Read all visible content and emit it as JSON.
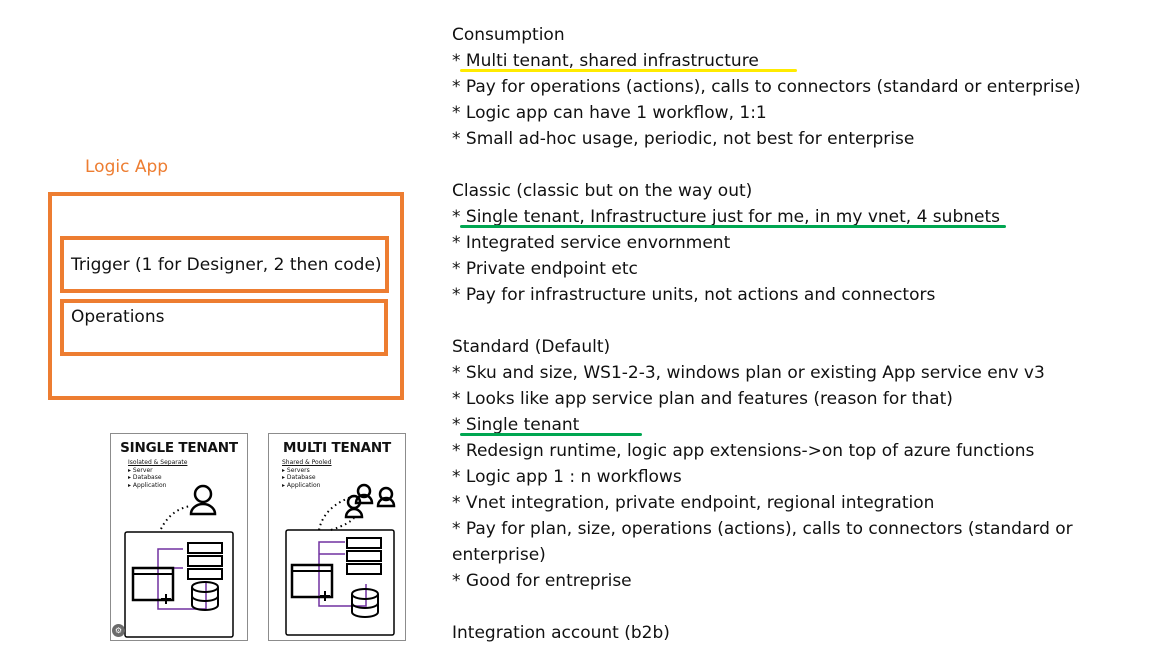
{
  "left": {
    "logic_title": "Logic App",
    "trigger_label": "Trigger (1 for Designer, 2 then code)",
    "operations_label": "Operations"
  },
  "cards": {
    "single": {
      "title": "SINGLE TENANT",
      "subtitle": "Isolated & Separate",
      "items": [
        "Server",
        "Database",
        "Application"
      ]
    },
    "multi": {
      "title": "MULTI TENANT",
      "subtitle": "Shared & Pooled",
      "items": [
        "Servers",
        "Database",
        "Application"
      ]
    }
  },
  "notes": {
    "lines": [
      "Consumption",
      "* Multi tenant, shared infrastructure",
      "* Pay for operations (actions), calls to connectors (standard or enterprise)",
      "* Logic app can have 1 workflow, 1:1",
      "* Small ad-hoc usage, periodic, not best for enterprise",
      "",
      "Classic (classic but on the way out)",
      "* Single tenant, Infrastructure just for me, in my vnet, 4 subnets",
      "* Integrated service envornment",
      "* Private endpoint etc",
      "* Pay for infrastructure units, not actions and connectors",
      "",
      "Standard (Default)",
      "* Sku and size, WS1-2-3, windows plan or existing App service env v3",
      "* Looks like app service plan and features (reason for that)",
      "* Single tenant",
      "* Redesign runtime, logic app extensions->on top of azure functions",
      "* Logic app 1 : n workflows",
      "* Vnet integration, private endpoint, regional integration",
      "* Pay for plan, size, operations (actions), calls to connectors (standard or enterprise)",
      "* Good for entreprise",
      "",
      "Integration account (b2b)"
    ]
  },
  "colors": {
    "orange": "#ed7d31",
    "yellow_highlight": "#ffeb00",
    "green_highlight": "#00a651",
    "purple_line": "#7030a0"
  }
}
